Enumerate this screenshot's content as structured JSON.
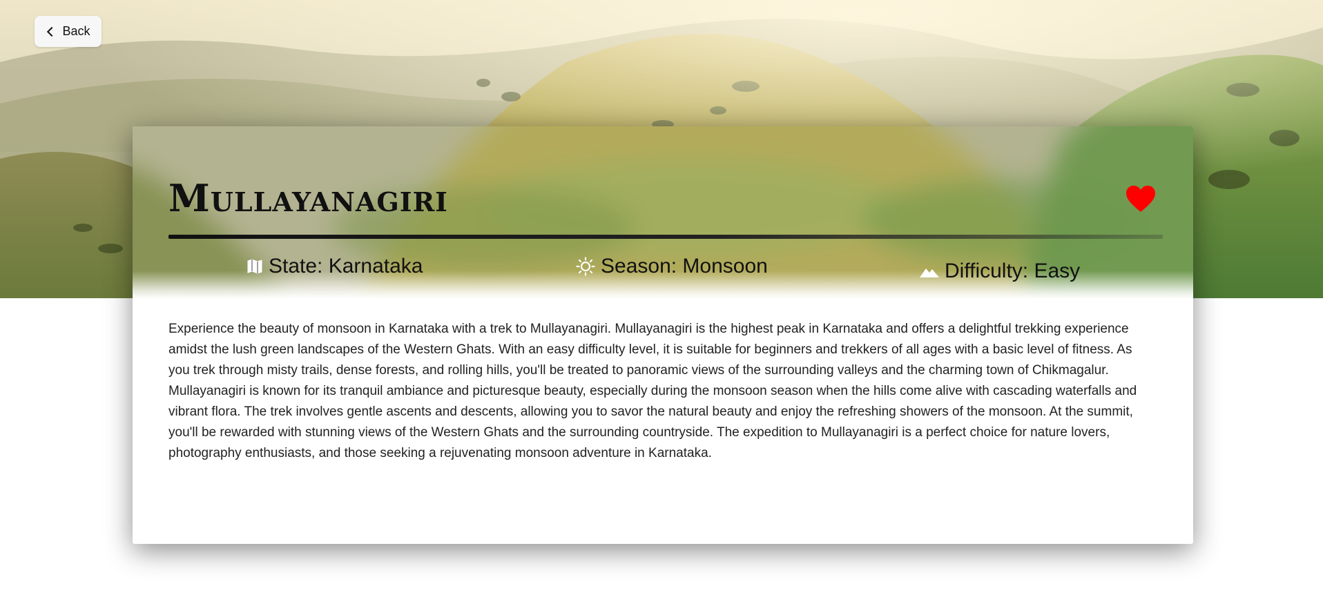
{
  "nav": {
    "back_label": "Back"
  },
  "trek": {
    "name": "Mullayanagiri",
    "favorited": true,
    "state": "State: Karnataka",
    "season": "Season: Monsoon",
    "difficulty": "Difficulty: Easy",
    "description": "Experience the beauty of monsoon in Karnataka with a trek to Mullayanagiri. Mullayanagiri is the highest peak in Karnataka and offers a delightful trekking experience amidst the lush green landscapes of the Western Ghats. With an easy difficulty level, it is suitable for beginners and trekkers of all ages with a basic level of fitness. As you trek through misty trails, dense forests, and rolling hills, you'll be treated to panoramic views of the surrounding valleys and the charming town of Chikmagalur. Mullayanagiri is known for its tranquil ambiance and picturesque beauty, especially during the monsoon season when the hills come alive with cascading waterfalls and vibrant flora. The trek involves gentle ascents and descents, allowing you to savor the natural beauty and enjoy the refreshing showers of the monsoon. At the summit, you'll be rewarded with stunning views of the Western Ghats and the surrounding countryside. The expedition to Mullayanagiri is a perfect choice for nature lovers, photography enthusiasts, and those seeking a rejuvenating monsoon adventure in Karnataka."
  },
  "icons": {
    "back": "chevron-left-icon",
    "favorite": "heart-icon",
    "state": "map-icon",
    "season": "sun-icon",
    "difficulty": "mountain-icon"
  },
  "colors": {
    "heart": "#ff0000",
    "text": "#111111",
    "card_bg": "#ffffff"
  }
}
